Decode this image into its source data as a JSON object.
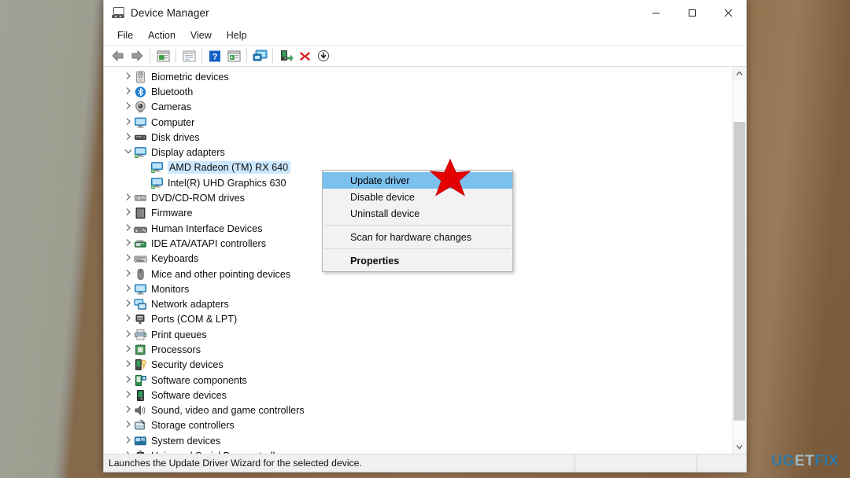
{
  "window": {
    "title": "Device Manager",
    "icon": "device-manager-icon",
    "controls": {
      "minimize": "–",
      "maximize": "□",
      "close": "✕"
    }
  },
  "menubar": {
    "items": [
      "File",
      "Action",
      "View",
      "Help"
    ]
  },
  "toolbar": {
    "buttons": [
      {
        "name": "back-icon",
        "glyph": "◄"
      },
      {
        "name": "forward-icon",
        "glyph": "►"
      },
      {
        "name": "separator",
        "glyph": ""
      },
      {
        "name": "properties-icon",
        "glyph": ""
      },
      {
        "name": "separator",
        "glyph": ""
      },
      {
        "name": "update-driver-icon",
        "glyph": ""
      },
      {
        "name": "separator",
        "glyph": ""
      },
      {
        "name": "help-icon",
        "glyph": "?"
      },
      {
        "name": "scan-hardware-icon",
        "glyph": ""
      },
      {
        "name": "separator",
        "glyph": ""
      },
      {
        "name": "show-hidden-devices-icon",
        "glyph": ""
      },
      {
        "name": "separator",
        "glyph": ""
      },
      {
        "name": "enable-device-icon",
        "glyph": ""
      },
      {
        "name": "uninstall-device-icon",
        "glyph": "✕"
      },
      {
        "name": "disable-device-icon",
        "glyph": "▼"
      }
    ]
  },
  "tree": {
    "items": [
      {
        "label": "Biometric devices",
        "icon": "fingerprint-icon",
        "chevron": "collapsed",
        "level": 0
      },
      {
        "label": "Bluetooth",
        "icon": "bluetooth-icon",
        "chevron": "collapsed",
        "level": 0
      },
      {
        "label": "Cameras",
        "icon": "camera-icon",
        "chevron": "collapsed",
        "level": 0
      },
      {
        "label": "Computer",
        "icon": "monitor-icon",
        "chevron": "collapsed",
        "level": 0
      },
      {
        "label": "Disk drives",
        "icon": "disk-drive-icon",
        "chevron": "collapsed",
        "level": 0
      },
      {
        "label": "Display adapters",
        "icon": "display-adapter-icon",
        "chevron": "expanded",
        "level": 0
      },
      {
        "label": "AMD Radeon (TM) RX 640",
        "icon": "display-adapter-icon",
        "chevron": "none",
        "level": 1,
        "selected": true
      },
      {
        "label": "Intel(R) UHD Graphics 630",
        "icon": "display-adapter-icon",
        "chevron": "none",
        "level": 1
      },
      {
        "label": "DVD/CD-ROM drives",
        "icon": "dvd-drive-icon",
        "chevron": "collapsed",
        "level": 0
      },
      {
        "label": "Firmware",
        "icon": "firmware-icon",
        "chevron": "collapsed",
        "level": 0
      },
      {
        "label": "Human Interface Devices",
        "icon": "hid-icon",
        "chevron": "collapsed",
        "level": 0
      },
      {
        "label": "IDE ATA/ATAPI controllers",
        "icon": "ide-controller-icon",
        "chevron": "collapsed",
        "level": 0
      },
      {
        "label": "Keyboards",
        "icon": "keyboard-icon",
        "chevron": "collapsed",
        "level": 0
      },
      {
        "label": "Mice and other pointing devices",
        "icon": "mouse-icon",
        "chevron": "collapsed",
        "level": 0
      },
      {
        "label": "Monitors",
        "icon": "monitor-icon",
        "chevron": "collapsed",
        "level": 0
      },
      {
        "label": "Network adapters",
        "icon": "network-adapter-icon",
        "chevron": "collapsed",
        "level": 0
      },
      {
        "label": "Ports (COM & LPT)",
        "icon": "port-icon",
        "chevron": "collapsed",
        "level": 0
      },
      {
        "label": "Print queues",
        "icon": "printer-icon",
        "chevron": "collapsed",
        "level": 0
      },
      {
        "label": "Processors",
        "icon": "processor-icon",
        "chevron": "collapsed",
        "level": 0
      },
      {
        "label": "Security devices",
        "icon": "security-device-icon",
        "chevron": "collapsed",
        "level": 0
      },
      {
        "label": "Software components",
        "icon": "software-component-icon",
        "chevron": "collapsed",
        "level": 0
      },
      {
        "label": "Software devices",
        "icon": "software-device-icon",
        "chevron": "collapsed",
        "level": 0
      },
      {
        "label": "Sound, video and game controllers",
        "icon": "speaker-icon",
        "chevron": "collapsed",
        "level": 0
      },
      {
        "label": "Storage controllers",
        "icon": "storage-controller-icon",
        "chevron": "collapsed",
        "level": 0
      },
      {
        "label": "System devices",
        "icon": "system-device-icon",
        "chevron": "collapsed",
        "level": 0
      },
      {
        "label": "Universal Serial Bus controllers",
        "icon": "usb-controller-icon",
        "chevron": "collapsed",
        "level": 0
      }
    ]
  },
  "context_menu": {
    "items": [
      {
        "label": "Update driver",
        "highlighted": true,
        "bold": false,
        "separator_after": false
      },
      {
        "label": "Disable device",
        "highlighted": false,
        "bold": false,
        "separator_after": false
      },
      {
        "label": "Uninstall device",
        "highlighted": false,
        "bold": false,
        "separator_after": true
      },
      {
        "label": "Scan for hardware changes",
        "highlighted": false,
        "bold": false,
        "separator_after": true
      },
      {
        "label": "Properties",
        "highlighted": false,
        "bold": true,
        "separator_after": false
      }
    ]
  },
  "statusbar": {
    "text": "Launches the Update Driver Wizard for the selected device.",
    "segment2": "",
    "segment3": ""
  },
  "annotation": {
    "pointer": "red-star-pointer"
  },
  "watermark": {
    "part1": "UG",
    "part2": "ET",
    "part3": "FIX"
  },
  "colors": {
    "selection_blue": "#cce8ff",
    "menu_highlight": "#7cc0ee",
    "accent_red": "#e00000",
    "window_bg": "#ffffff",
    "statusbar_bg": "#f0f0f0",
    "desktop_brown": "#9a7550",
    "desktop_gray": "#a9a99b"
  }
}
